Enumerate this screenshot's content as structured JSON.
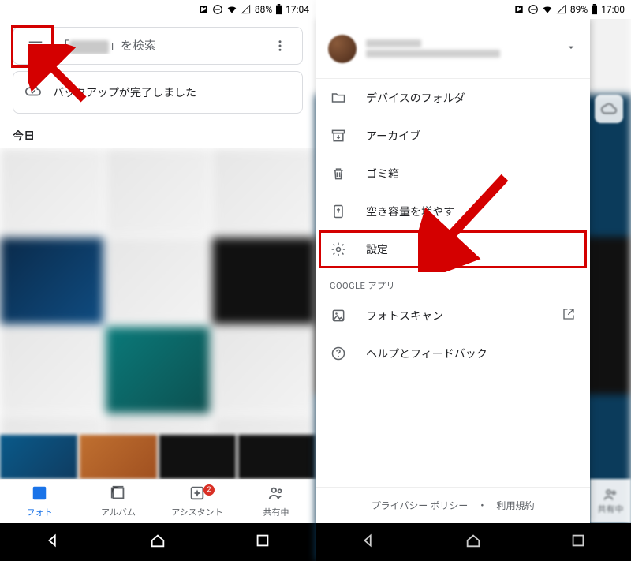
{
  "left": {
    "status": {
      "battery": "88%",
      "time": "17:04"
    },
    "search": {
      "prefix": "「",
      "suffix": "」を検索"
    },
    "backup": {
      "text": "バックアップが完了しました"
    },
    "section_today": "今日",
    "nav": {
      "photo": "フォト",
      "album": "アルバム",
      "assistant": "アシスタント",
      "share": "共有中",
      "badge": "2"
    }
  },
  "right": {
    "status": {
      "battery": "89%",
      "time": "17:00"
    },
    "drawer": {
      "items": {
        "device_folders": "デバイスのフォルダ",
        "archive": "アーカイブ",
        "trash": "ゴミ箱",
        "free_space": "空き容量を増やす",
        "settings": "設定",
        "photoscan": "フォトスキャン",
        "help": "ヘルプとフィードバック"
      },
      "subhead": "GOOGLE アプリ",
      "footer": {
        "privacy": "プライバシー ポリシー",
        "terms": "利用規約"
      }
    },
    "bg_share": "共有中"
  }
}
